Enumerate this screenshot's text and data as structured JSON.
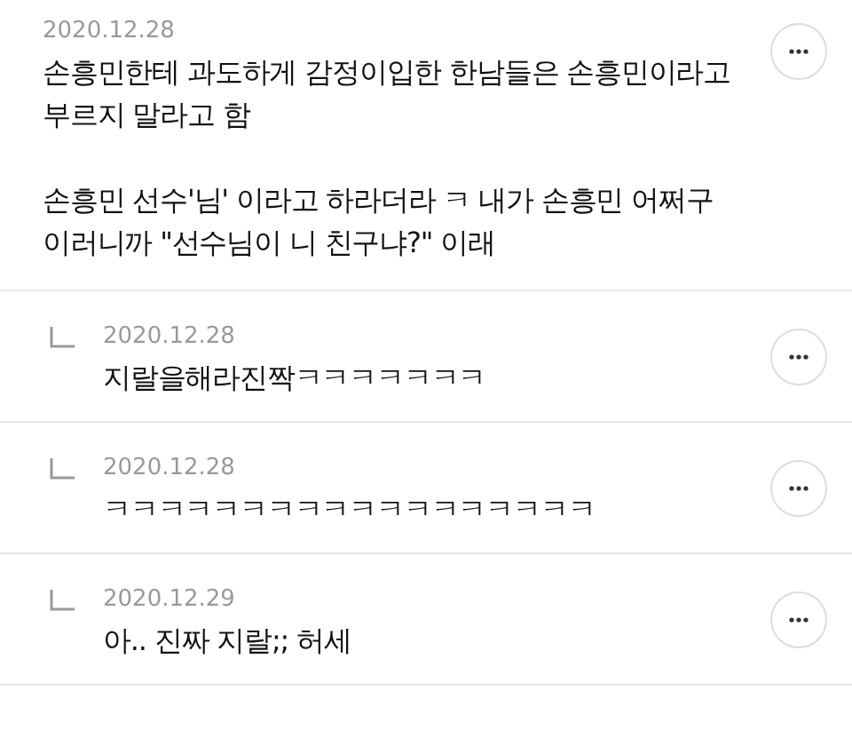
{
  "comments": [
    {
      "kind": "comment",
      "date": "2020.12.28",
      "paragraphs": [
        "손흥민한테 과도하게 감정이입한 한남들은 손흥민이라고\n부르지 말라고 함",
        "손흥민 선수'님' 이라고 하라더라 ㅋ 내가 손흥민 어쩌구\n이러니까 \"선수님이 니 친구냐?\" 이래"
      ]
    },
    {
      "kind": "reply",
      "date": "2020.12.28",
      "paragraphs": [
        "지랄을해라진짝ㅋㅋㅋㅋㅋㅋㅋ"
      ]
    },
    {
      "kind": "reply",
      "date": "2020.12.28",
      "paragraphs": [
        "ㅋㅋㅋㅋㅋㅋㅋㅋㅋㅋㅋㅋㅋㅋㅋㅋㅋㅋ"
      ]
    },
    {
      "kind": "reply",
      "date": "2020.12.29",
      "paragraphs": [
        "아.. 진짜 지랄;; 허세"
      ]
    }
  ]
}
